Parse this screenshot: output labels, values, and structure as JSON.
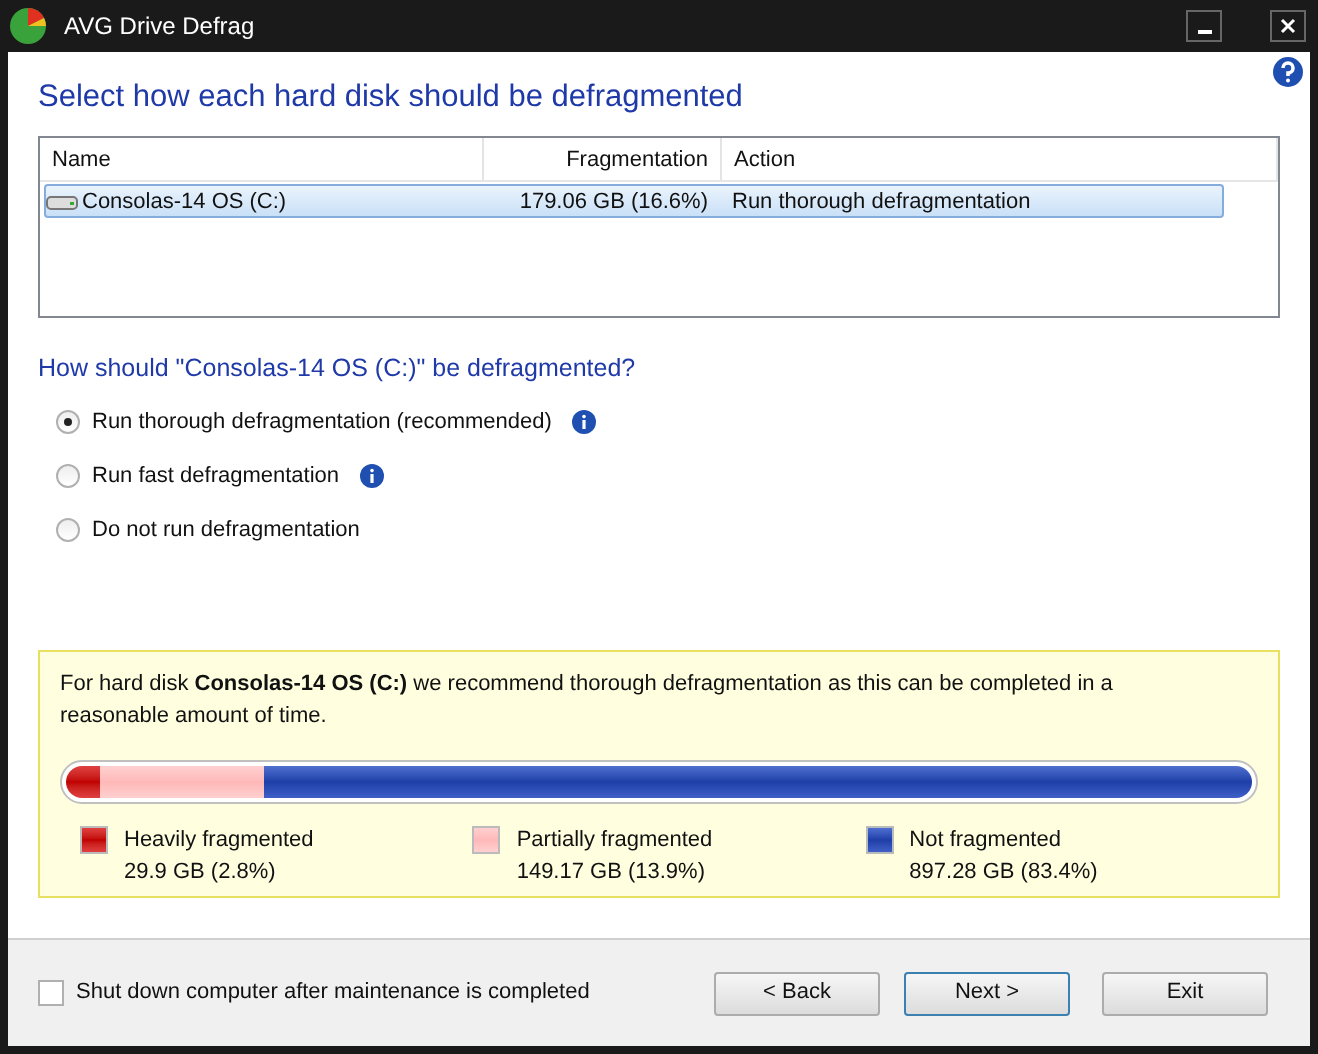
{
  "window": {
    "title": "AVG Drive Defrag"
  },
  "heading": "Select how each hard disk should be defragmented",
  "table": {
    "columns": [
      "Name",
      "Fragmentation",
      "Action"
    ],
    "rows": [
      {
        "name": "Consolas-14 OS (C:)",
        "fragmentation": "179.06 GB (16.6%)",
        "action": "Run thorough defragmentation",
        "selected": true
      }
    ]
  },
  "question": "How should \"Consolas-14 OS (C:)\" be defragmented?",
  "options": [
    {
      "label": "Run thorough defragmentation (recommended)",
      "selected": true,
      "info": true
    },
    {
      "label": "Run fast defragmentation",
      "selected": false,
      "info": true
    },
    {
      "label": "Do not run defragmentation",
      "selected": false,
      "info": false
    }
  ],
  "recommendation": "For hard disk **Consolas-14 OS (C:)** we recommend thorough defragmentation as this can be completed in a reasonable amount of time.",
  "legend": [
    {
      "kind": "heavy",
      "label": "Heavily fragmented",
      "amount": "29.9 GB (2.8%)",
      "level": 0.028
    },
    {
      "kind": "partial",
      "label": "Partially fragmented",
      "amount": "149.17 GB (13.9%)",
      "level": 0.139
    },
    {
      "kind": "none",
      "label": "Not fragmented",
      "amount": "897.28 GB (83.4%)",
      "level": 0.834
    }
  ],
  "shutdown": {
    "label": "Shut down computer after maintenance is completed",
    "checked": false
  },
  "buttons": [
    "< Back",
    "Next >",
    "Exit"
  ]
}
